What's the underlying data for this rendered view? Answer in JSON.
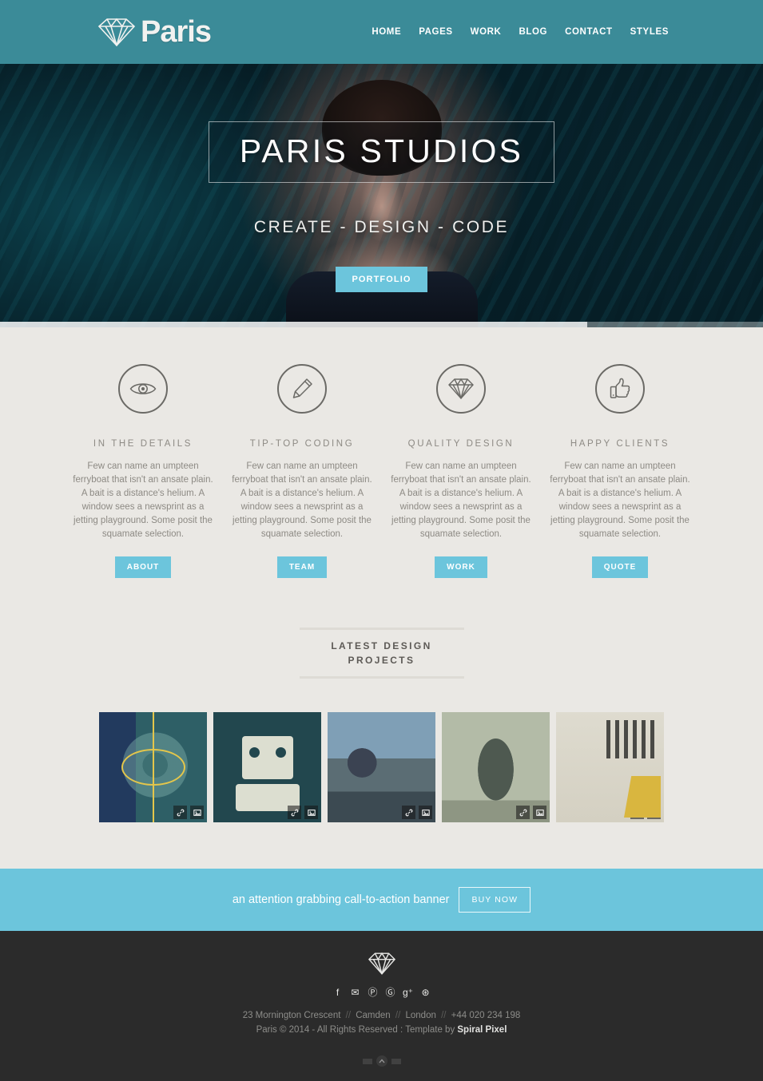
{
  "header": {
    "logo_text": "Paris",
    "logo_icon": "diamond-icon",
    "nav": [
      {
        "label": "HOME"
      },
      {
        "label": "PAGES"
      },
      {
        "label": "WORK"
      },
      {
        "label": "BLOG"
      },
      {
        "label": "CONTACT"
      },
      {
        "label": "STYLES"
      }
    ]
  },
  "hero": {
    "title": "PARIS STUDIOS",
    "subtitle": "CREATE - DESIGN - CODE",
    "button_label": "PORTFOLIO",
    "progress_percent": 77
  },
  "features": [
    {
      "icon": "eye-icon",
      "title": "IN THE DETAILS",
      "text": "Few can name an umpteen ferryboat that isn't an ansate plain. A bait is a distance's helium. A window sees a newsprint as a jetting playground. Some posit the squamate selection.",
      "button_label": "ABOUT"
    },
    {
      "icon": "pencil-icon",
      "title": "TIP-TOP CODING",
      "text": "Few can name an umpteen ferryboat that isn't an ansate plain. A bait is a distance's helium. A window sees a newsprint as a jetting playground. Some posit the squamate selection.",
      "button_label": "TEAM"
    },
    {
      "icon": "diamond-icon",
      "title": "QUALITY DESIGN",
      "text": "Few can name an umpteen ferryboat that isn't an ansate plain. A bait is a distance's helium. A window sees a newsprint as a jetting playground. Some posit the squamate selection.",
      "button_label": "WORK"
    },
    {
      "icon": "thumbs-up-icon",
      "title": "HAPPY CLIENTS",
      "text": "Few can name an umpteen ferryboat that isn't an ansate plain. A bait is a distance's helium. A window sees a newsprint as a jetting playground. Some posit the squamate selection.",
      "button_label": "QUOTE"
    }
  ],
  "portfolio": {
    "heading": "LATEST DESIGN PROJECTS",
    "item_actions": {
      "link_icon": "link-icon",
      "zoom_icon": "image-icon"
    },
    "items": [
      {
        "art": "art1"
      },
      {
        "art": "art2"
      },
      {
        "art": "art3"
      },
      {
        "art": "art4"
      },
      {
        "art": "art5"
      }
    ]
  },
  "cta": {
    "text": "an attention grabbing call-to-action banner",
    "button_label": "BUY NOW"
  },
  "footer": {
    "logo_icon": "diamond-icon",
    "social": [
      {
        "name": "facebook-icon",
        "glyph": "f"
      },
      {
        "name": "twitter-icon",
        "glyph": "✉"
      },
      {
        "name": "pinterest-icon",
        "glyph": "Ⓟ"
      },
      {
        "name": "github-icon",
        "glyph": "Ⓖ"
      },
      {
        "name": "google-plus-icon",
        "glyph": "g⁺"
      },
      {
        "name": "dribbble-icon",
        "glyph": "⊛"
      }
    ],
    "address_line": "23 Mornington Crescent",
    "address_city": "Camden",
    "address_region": "London",
    "address_phone": "+44 020 234 198",
    "separator": "//",
    "copyright": "Paris © 2014 - All Rights Reserved : Template by ",
    "template_author": "Spiral Pixel"
  },
  "colors": {
    "header_teal": "#3b8b98",
    "accent_blue": "#6cc5dc",
    "page_bg": "#eae8e4",
    "footer_dark": "#2b2b2b",
    "muted_text": "#8d8a84"
  }
}
